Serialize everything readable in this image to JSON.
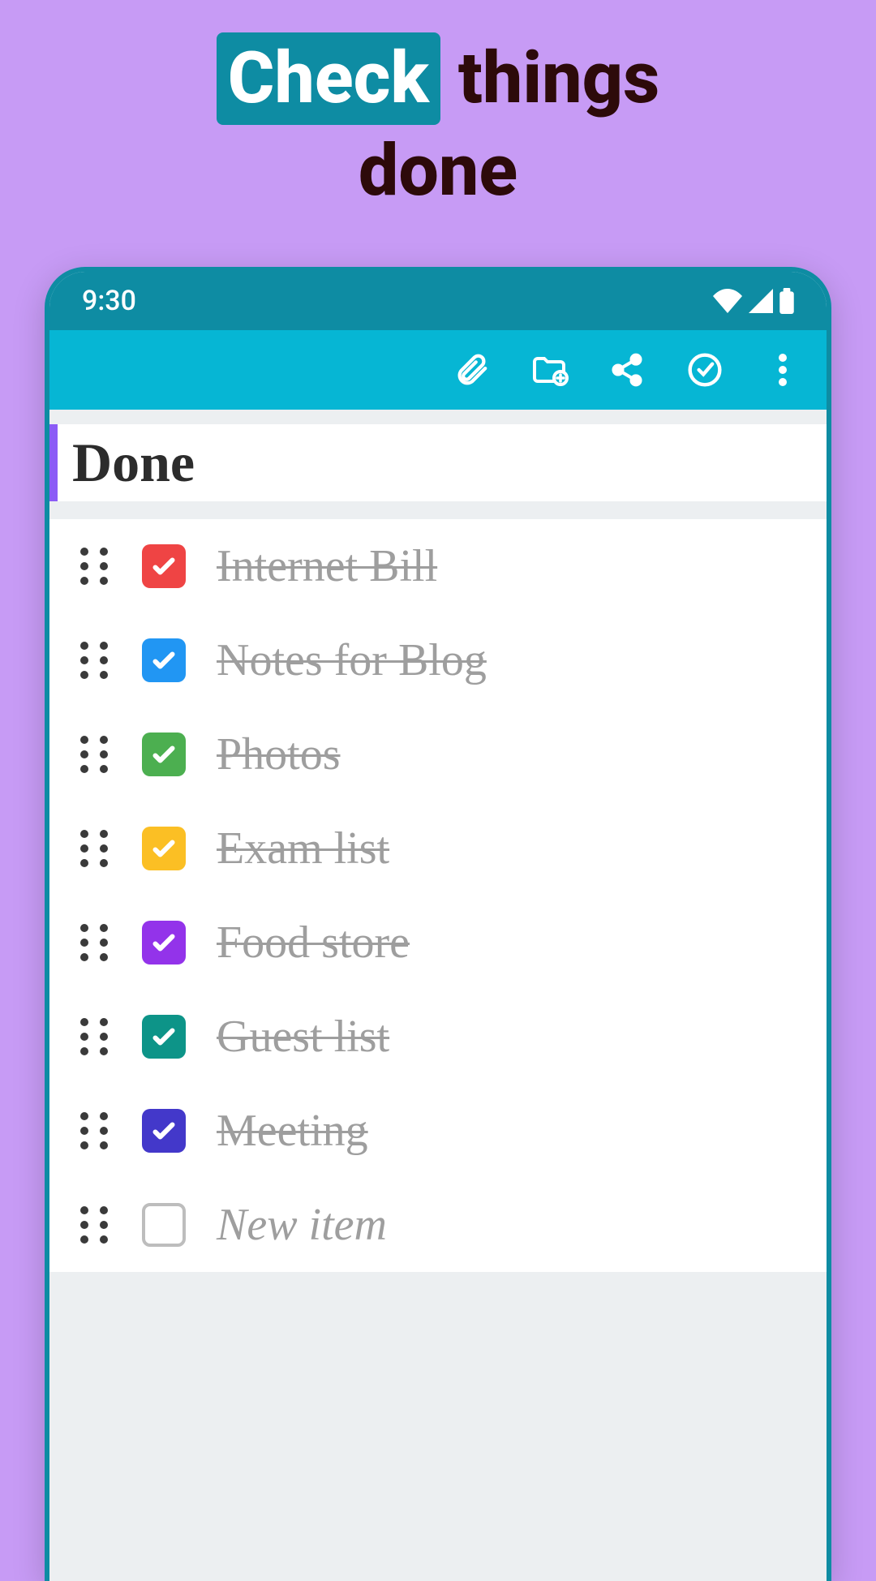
{
  "promo": {
    "highlight": "Check",
    "rest1": "things",
    "rest2": "done"
  },
  "statusbar": {
    "time": "9:30"
  },
  "note": {
    "title": "Done",
    "new_item_placeholder": "New item"
  },
  "items": [
    {
      "label": "Internet Bill",
      "checked": true,
      "color": "#ef4444"
    },
    {
      "label": "Notes for Blog",
      "checked": true,
      "color": "#2196f3"
    },
    {
      "label": "Photos",
      "checked": true,
      "color": "#4caf50"
    },
    {
      "label": "Exam list",
      "checked": true,
      "color": "#fbbf24"
    },
    {
      "label": "Food store",
      "checked": true,
      "color": "#9333ea"
    },
    {
      "label": "Guest list",
      "checked": true,
      "color": "#0d9488"
    },
    {
      "label": "Meeting",
      "checked": true,
      "color": "#4338ca"
    }
  ],
  "toolbar_icons": [
    "attach",
    "folder-add",
    "share",
    "check-all",
    "overflow"
  ]
}
